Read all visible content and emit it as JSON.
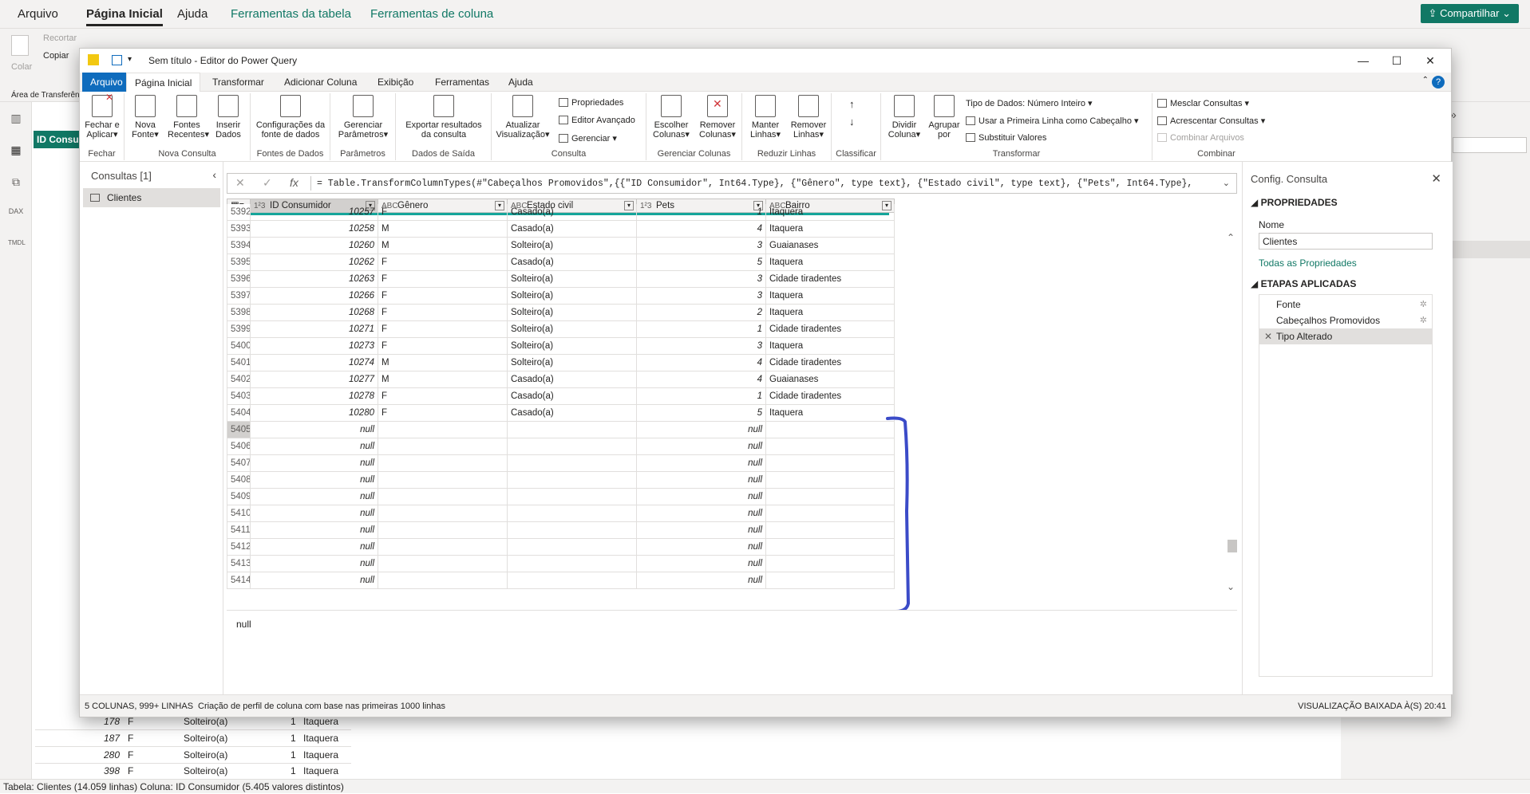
{
  "bg": {
    "menu": [
      "Arquivo",
      "Página Inicial",
      "Ajuda",
      "Ferramentas da tabela",
      "Ferramentas de coluna"
    ],
    "share": "Compartilhar",
    "ribbon": {
      "cut": "Recortar",
      "paste": "Colar",
      "copy": "Copiar",
      "clipboard": "Área de Transferência"
    },
    "table_col_header": "ID Consumidor",
    "rows": [
      {
        "id": "178",
        "g": "F",
        "e": "Solteiro(a)",
        "p": "1",
        "b": "Itaquera"
      },
      {
        "id": "187",
        "g": "F",
        "e": "Solteiro(a)",
        "p": "1",
        "b": "Itaquera"
      },
      {
        "id": "280",
        "g": "F",
        "e": "Solteiro(a)",
        "p": "1",
        "b": "Itaquera"
      },
      {
        "id": "398",
        "g": "F",
        "e": "Solteiro(a)",
        "p": "1",
        "b": "Itaquera"
      }
    ],
    "status": "Tabela: Clientes (14.059 linhas) Coluna: ID Consumidor (5.405 valores distintos)"
  },
  "pq": {
    "title": "Sem título - Editor do Power Query",
    "tabs": [
      "Arquivo",
      "Página Inicial",
      "Transformar",
      "Adicionar Coluna",
      "Exibição",
      "Ferramentas",
      "Ajuda"
    ],
    "ribbon": {
      "fechar": {
        "btn1": "Fechar e",
        "btn2": "Aplicar",
        "label": "Fechar"
      },
      "nova": {
        "b1a": "Nova",
        "b1b": "Fonte",
        "b2a": "Fontes",
        "b2b": "Recentes",
        "b3a": "Inserir",
        "b3b": "Dados",
        "label": "Nova Consulta"
      },
      "fontes": {
        "b1a": "Configurações da",
        "b1b": "fonte de dados",
        "label": "Fontes de Dados"
      },
      "params": {
        "b1a": "Gerenciar",
        "b1b": "Parâmetros",
        "label": "Parâmetros"
      },
      "saida": {
        "b1a": "Exportar resultados",
        "b1b": "da consulta",
        "label": "Dados de Saída"
      },
      "consulta": {
        "b1a": "Atualizar",
        "b1b": "Visualização",
        "s1": "Propriedades",
        "s2": "Editor Avançado",
        "s3": "Gerenciar",
        "label": "Consulta"
      },
      "colunas": {
        "b1a": "Escolher",
        "b1b": "Colunas",
        "b2a": "Remover",
        "b2b": "Colunas",
        "label": "Gerenciar Colunas"
      },
      "linhas": {
        "b1a": "Manter",
        "b1b": "Linhas",
        "b2a": "Remover",
        "b2b": "Linhas",
        "label": "Reduzir Linhas"
      },
      "classificar": {
        "label": "Classificar"
      },
      "transformar": {
        "b1a": "Dividir",
        "b1b": "Coluna",
        "b2a": "Agrupar",
        "b2b": "por",
        "s1": "Tipo de Dados: Número Inteiro",
        "s2": "Usar a Primeira Linha como Cabeçalho",
        "s3": "Substituir Valores",
        "label": "Transformar"
      },
      "combinar": {
        "s1": "Mesclar Consultas",
        "s2": "Acrescentar Consultas",
        "s3": "Combinar Arquivos",
        "label": "Combinar"
      }
    },
    "queries": {
      "title": "Consultas [1]",
      "item": "Clientes"
    },
    "formula": "= Table.TransformColumnTypes(#\"Cabeçalhos Promovidos\",{{\"ID Consumidor\", Int64.Type}, {\"Gênero\", type text}, {\"Estado civil\", type text}, {\"Pets\", Int64.Type},",
    "columns": [
      {
        "name": "ID Consumidor",
        "type": "1²3"
      },
      {
        "name": "Gênero",
        "type": "ABC"
      },
      {
        "name": "Estado civil",
        "type": "ABC"
      },
      {
        "name": "Pets",
        "type": "1²3"
      },
      {
        "name": "Bairro",
        "type": "ABC"
      }
    ],
    "rows": [
      {
        "i": "5392",
        "id": "10257",
        "g": "F",
        "e": "Casado(a)",
        "p": "1",
        "b": "Itaquera"
      },
      {
        "i": "5393",
        "id": "10258",
        "g": "M",
        "e": "Casado(a)",
        "p": "4",
        "b": "Itaquera"
      },
      {
        "i": "5394",
        "id": "10260",
        "g": "M",
        "e": "Solteiro(a)",
        "p": "3",
        "b": "Guaianases"
      },
      {
        "i": "5395",
        "id": "10262",
        "g": "F",
        "e": "Casado(a)",
        "p": "5",
        "b": "Itaquera"
      },
      {
        "i": "5396",
        "id": "10263",
        "g": "F",
        "e": "Solteiro(a)",
        "p": "3",
        "b": "Cidade tiradentes"
      },
      {
        "i": "5397",
        "id": "10266",
        "g": "F",
        "e": "Solteiro(a)",
        "p": "3",
        "b": "Itaquera"
      },
      {
        "i": "5398",
        "id": "10268",
        "g": "F",
        "e": "Solteiro(a)",
        "p": "2",
        "b": "Itaquera"
      },
      {
        "i": "5399",
        "id": "10271",
        "g": "F",
        "e": "Solteiro(a)",
        "p": "1",
        "b": "Cidade tiradentes"
      },
      {
        "i": "5400",
        "id": "10273",
        "g": "F",
        "e": "Solteiro(a)",
        "p": "3",
        "b": "Itaquera"
      },
      {
        "i": "5401",
        "id": "10274",
        "g": "M",
        "e": "Solteiro(a)",
        "p": "4",
        "b": "Cidade tiradentes"
      },
      {
        "i": "5402",
        "id": "10277",
        "g": "M",
        "e": "Casado(a)",
        "p": "4",
        "b": "Guaianases"
      },
      {
        "i": "5403",
        "id": "10278",
        "g": "F",
        "e": "Casado(a)",
        "p": "1",
        "b": "Cidade tiradentes"
      },
      {
        "i": "5404",
        "id": "10280",
        "g": "F",
        "e": "Casado(a)",
        "p": "5",
        "b": "Itaquera"
      },
      {
        "i": "5405",
        "id": "null",
        "g": "",
        "e": "",
        "p": "null",
        "b": ""
      },
      {
        "i": "5406",
        "id": "null",
        "g": "",
        "e": "",
        "p": "null",
        "b": ""
      },
      {
        "i": "5407",
        "id": "null",
        "g": "",
        "e": "",
        "p": "null",
        "b": ""
      },
      {
        "i": "5408",
        "id": "null",
        "g": "",
        "e": "",
        "p": "null",
        "b": ""
      },
      {
        "i": "5409",
        "id": "null",
        "g": "",
        "e": "",
        "p": "null",
        "b": ""
      },
      {
        "i": "5410",
        "id": "null",
        "g": "",
        "e": "",
        "p": "null",
        "b": ""
      },
      {
        "i": "5411",
        "id": "null",
        "g": "",
        "e": "",
        "p": "null",
        "b": ""
      },
      {
        "i": "5412",
        "id": "null",
        "g": "",
        "e": "",
        "p": "null",
        "b": ""
      },
      {
        "i": "5413",
        "id": "null",
        "g": "",
        "e": "",
        "p": "null",
        "b": ""
      },
      {
        "i": "5414",
        "id": "null",
        "g": "",
        "e": "",
        "p": "null",
        "b": ""
      }
    ],
    "preview_value": "null",
    "settings": {
      "title": "Config. Consulta",
      "properties": "PROPRIEDADES",
      "name_label": "Nome",
      "name_value": "Clientes",
      "all_props": "Todas as Propriedades",
      "steps_title": "ETAPAS APLICADAS",
      "steps": [
        "Fonte",
        "Cabeçalhos Promovidos",
        "Tipo Alterado"
      ]
    },
    "status_left": "5 COLUNAS, 999+ LINHAS",
    "status_mid": "Criação de perfil de coluna com base nas primeiras 1000 linhas",
    "status_right": "VISUALIZAÇÃO BAIXADA À(S) 20:41"
  },
  "colors": {
    "accent": "#0f6cbd",
    "brand": "#117865",
    "teal": "#15a59a",
    "annotation": "#3b4bc8"
  }
}
